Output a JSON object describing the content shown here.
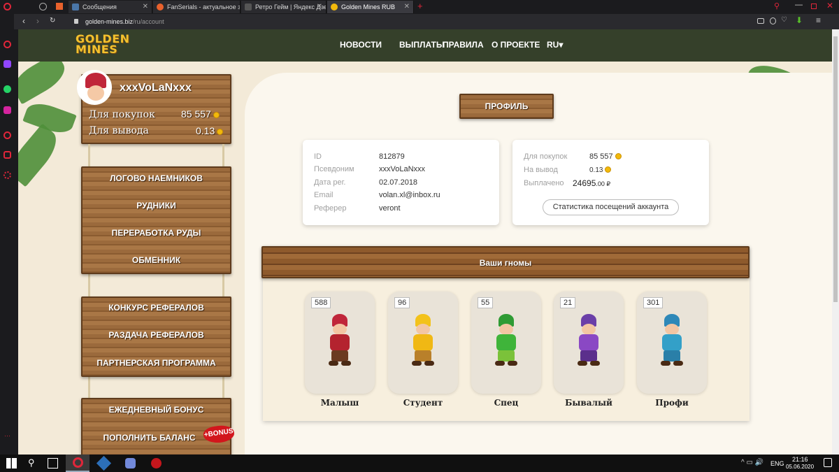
{
  "browser": {
    "tabs": [
      {
        "title": "Сообщения",
        "color": "#4a76a8"
      },
      {
        "title": "FanSerials - актуальное зе",
        "color": "#e8612c"
      },
      {
        "title": "Ретро Гейм | Яндекс Дзен",
        "color": "#333333"
      },
      {
        "title": "Golden Mines RUB",
        "color": "#f2b90c"
      }
    ],
    "url_host": "golden-mines.biz",
    "url_path": "/ru/account"
  },
  "site": {
    "logo_line1": "GOLDEN",
    "logo_line2": "MINES",
    "nav": [
      "НОВОСТИ",
      "ВЫПЛАТЫ",
      "ПРАВИЛА",
      "О ПРОЕКТЕ",
      "RU▾"
    ]
  },
  "user": {
    "name": "xxxVoLaNxxx",
    "purchase_label": "Для покупок",
    "purchase_value": "85 557",
    "withdraw_label": "Для вывода",
    "withdraw_value": "0.13"
  },
  "menu": {
    "group1": [
      "ЛОГОВО НАЕМНИКОВ",
      "РУДНИКИ",
      "ПЕРЕРАБОТКА РУДЫ",
      "ОБМЕННИК"
    ],
    "group2": [
      "КОНКУРС РЕФЕРАЛОВ",
      "РАЗДАЧА РЕФЕРАЛОВ",
      "ПАРТНЕРСКАЯ ПРОГРАММА"
    ],
    "group3": [
      "ЕЖЕДНЕВНЫЙ БОНУС",
      "ПОПОЛНИТЬ БАЛАНС"
    ],
    "bonus_badge": "+BONUS"
  },
  "profile": {
    "title": "ПРОФИЛЬ",
    "info": [
      {
        "label": "ID",
        "value": "812879"
      },
      {
        "label": "Псевдоним",
        "value": "xxxVoLaNxxx"
      },
      {
        "label": "Дата рег.",
        "value": "02.07.2018"
      },
      {
        "label": "Email",
        "value": "volan.xl@inbox.ru"
      },
      {
        "label": "Реферер",
        "value": "veront"
      }
    ],
    "balance": {
      "purchase_label": "Для покупок",
      "purchase_value": "85 557",
      "withdraw_label": "На вывод",
      "withdraw_value": "0.13",
      "paid_label": "Выплачено",
      "paid_int": "24695",
      "paid_dec": ".00 ₽"
    },
    "stats_button": "Статистика посещений аккаунта"
  },
  "gnomes": {
    "title": "Ваши гномы",
    "items": [
      {
        "name": "Малыш",
        "count": "588",
        "hat": "#c0263a",
        "body": "#b4232f",
        "pants": "#6b3b22"
      },
      {
        "name": "Студент",
        "count": "96",
        "hat": "#f3c21a",
        "body": "#f0b814",
        "pants": "#b9802a"
      },
      {
        "name": "Спец",
        "count": "55",
        "hat": "#2f9b34",
        "body": "#3fb43a",
        "pants": "#7bc23a"
      },
      {
        "name": "Бывалый",
        "count": "21",
        "hat": "#6b3fa8",
        "body": "#8a48c4",
        "pants": "#5b2f8c"
      },
      {
        "name": "Профи",
        "count": "301",
        "hat": "#2e88b8",
        "body": "#33a0c8",
        "pants": "#2a7fa8"
      }
    ]
  },
  "taskbar": {
    "lang": "ENG",
    "time": "21:16",
    "date": "05.06.2020"
  }
}
